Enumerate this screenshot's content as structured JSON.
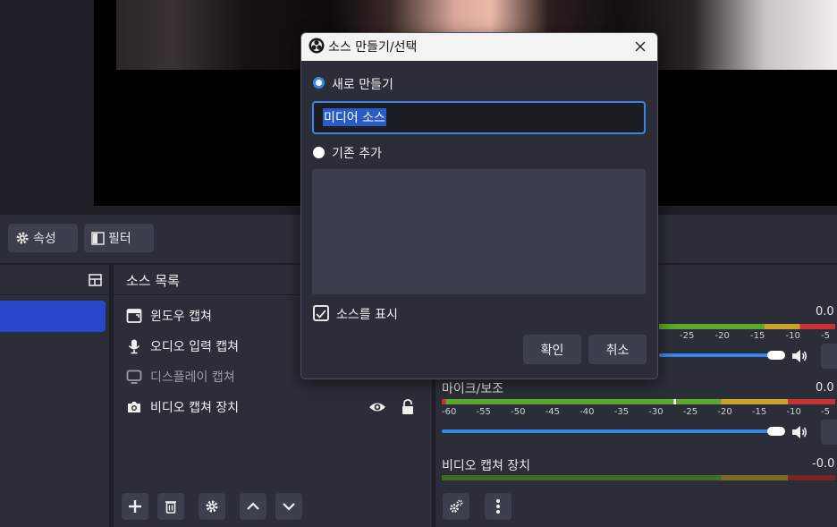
{
  "toolbar": {
    "properties_label": "속성",
    "filters_label": "필터"
  },
  "sources": {
    "title": "소스 목록",
    "items": [
      {
        "label": "윈도우 캡쳐",
        "icon": "window-icon",
        "dim": false
      },
      {
        "label": "오디오 입력 캡쳐",
        "icon": "microphone-icon",
        "dim": false
      },
      {
        "label": "디스플레이 캡쳐",
        "icon": "monitor-icon",
        "dim": true
      },
      {
        "label": "비디오 캡쳐 장치",
        "icon": "camera-icon",
        "dim": false
      }
    ]
  },
  "mixer": {
    "channels": [
      {
        "name": "",
        "db": "0.0"
      },
      {
        "name": "마이크/보조",
        "db": "0.0"
      },
      {
        "name": "비디오 캡쳐 장치",
        "db": "-0.0"
      }
    ],
    "scale": [
      "-60",
      "-55",
      "-50",
      "-45",
      "-40",
      "-35",
      "-30",
      "-25",
      "-20",
      "-15",
      "-10",
      "-5"
    ],
    "scale_partial": [
      "-25",
      "-20",
      "-15",
      "-10",
      "-5"
    ]
  },
  "dialog": {
    "title": "소스 만들기/선택",
    "create_new_label": "새로 만들기",
    "name_value": "미디어 소스",
    "add_existing_label": "기존 추가",
    "make_visible_label": "소스를 표시",
    "ok_label": "확인",
    "cancel_label": "취소",
    "create_new_selected": true,
    "make_visible_checked": true
  },
  "colors": {
    "accent": "#3a86e8",
    "selected_scene": "#2947c9",
    "panel": "#2b2e38",
    "meter_green": "#5ba82c",
    "meter_yellow": "#c8a22c",
    "meter_red": "#c83232"
  }
}
